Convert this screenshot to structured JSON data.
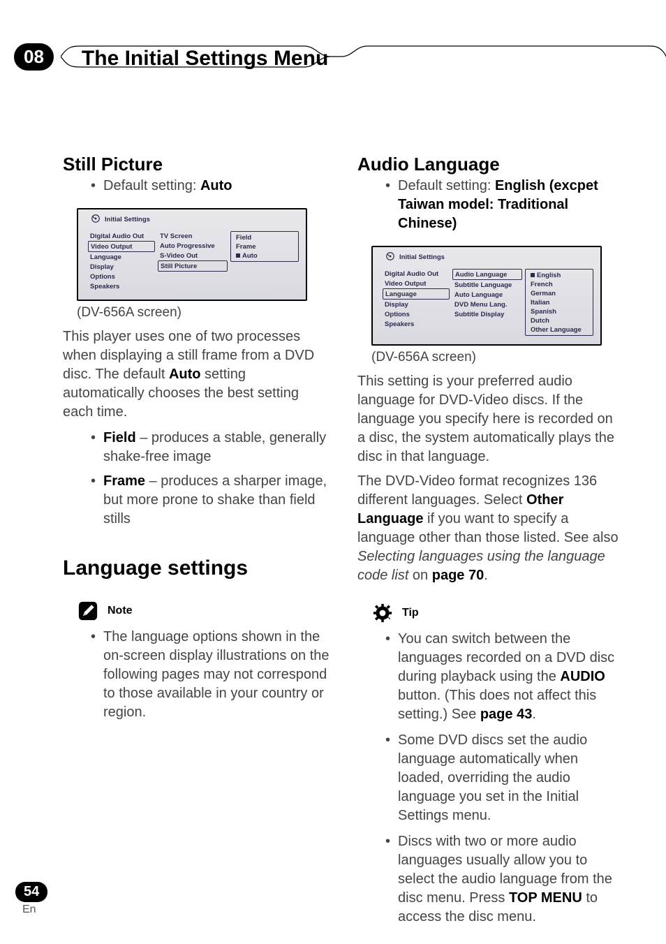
{
  "header": {
    "chapter": "08",
    "title": "The Initial Settings Menu"
  },
  "footer": {
    "page": "54",
    "lang": "En"
  },
  "left": {
    "section1_title": "Still Picture",
    "default_prefix": "Default setting: ",
    "default_value": "Auto",
    "fig_title": "Initial Settings",
    "fig_colA": [
      "Digital Audio Out",
      "Video Output",
      "Language",
      "Display",
      "Options",
      "Speakers"
    ],
    "fig_colB": [
      "TV Screen",
      "Auto Progressive",
      "S-Video Out",
      "Still Picture"
    ],
    "fig_colC": [
      "Field",
      "Frame",
      "Auto"
    ],
    "caption": "(DV-656A screen)",
    "para1_a": "This player uses one of two processes when displaying a still frame from a DVD disc. The default ",
    "para1_bold": "Auto",
    "para1_b": " setting automatically chooses the best setting each time.",
    "b1_bold": "Field",
    "b1_rest": " – produces a stable, generally shake-free image",
    "b2_bold": "Frame",
    "b2_rest": " – produces a sharper image, but more prone to shake than field stills",
    "section2_title": "Language settings",
    "note_label": "Note",
    "note_text": "The language options shown in the on-screen display illustrations on the following pages may not correspond to those available in your country or region."
  },
  "right": {
    "section1_title": "Audio Language",
    "default_prefix": "Default setting: ",
    "default_value": "English (excpet Taiwan model: Traditional Chinese)",
    "fig_title": "Initial Settings",
    "fig_colA": [
      "Digital Audio Out",
      "Video Output",
      "Language",
      "Display",
      "Options",
      "Speakers"
    ],
    "fig_colB": [
      "Audio Language",
      "Subtitle Language",
      "Auto Language",
      "DVD Menu Lang.",
      "Subtitle Display"
    ],
    "fig_colC": [
      "English",
      "French",
      "German",
      "Italian",
      "Spanish",
      "Dutch",
      "Other Language"
    ],
    "caption": "(DV-656A screen)",
    "para1": "This setting is your preferred audio language for DVD-Video discs. If the language you specify here is recorded on a disc, the system automatically plays the disc in that language.",
    "para2_a": "The DVD-Video format recognizes 136 different languages. Select ",
    "para2_bold1": "Other Language",
    "para2_b": " if you want to specify a language other than those listed. See also ",
    "para2_ital": "Selecting languages using the language code list",
    "para2_c": " on ",
    "para2_bold2": "page 70",
    "para2_d": ".",
    "tip_label": "Tip",
    "tip1_a": "You can switch between the languages recorded on a DVD disc during playback using the ",
    "tip1_bold1": "AUDIO",
    "tip1_b": " button. (This does not affect this setting.) See ",
    "tip1_bold2": "page 43",
    "tip1_c": ".",
    "tip2": "Some DVD discs set the audio language automatically when loaded, overriding the audio language you set in the Initial Settings menu.",
    "tip3_a": "Discs with two or more audio languages usually allow you to select the audio language from the disc menu. Press ",
    "tip3_bold": "TOP MENU",
    "tip3_b": " to access the disc menu."
  }
}
